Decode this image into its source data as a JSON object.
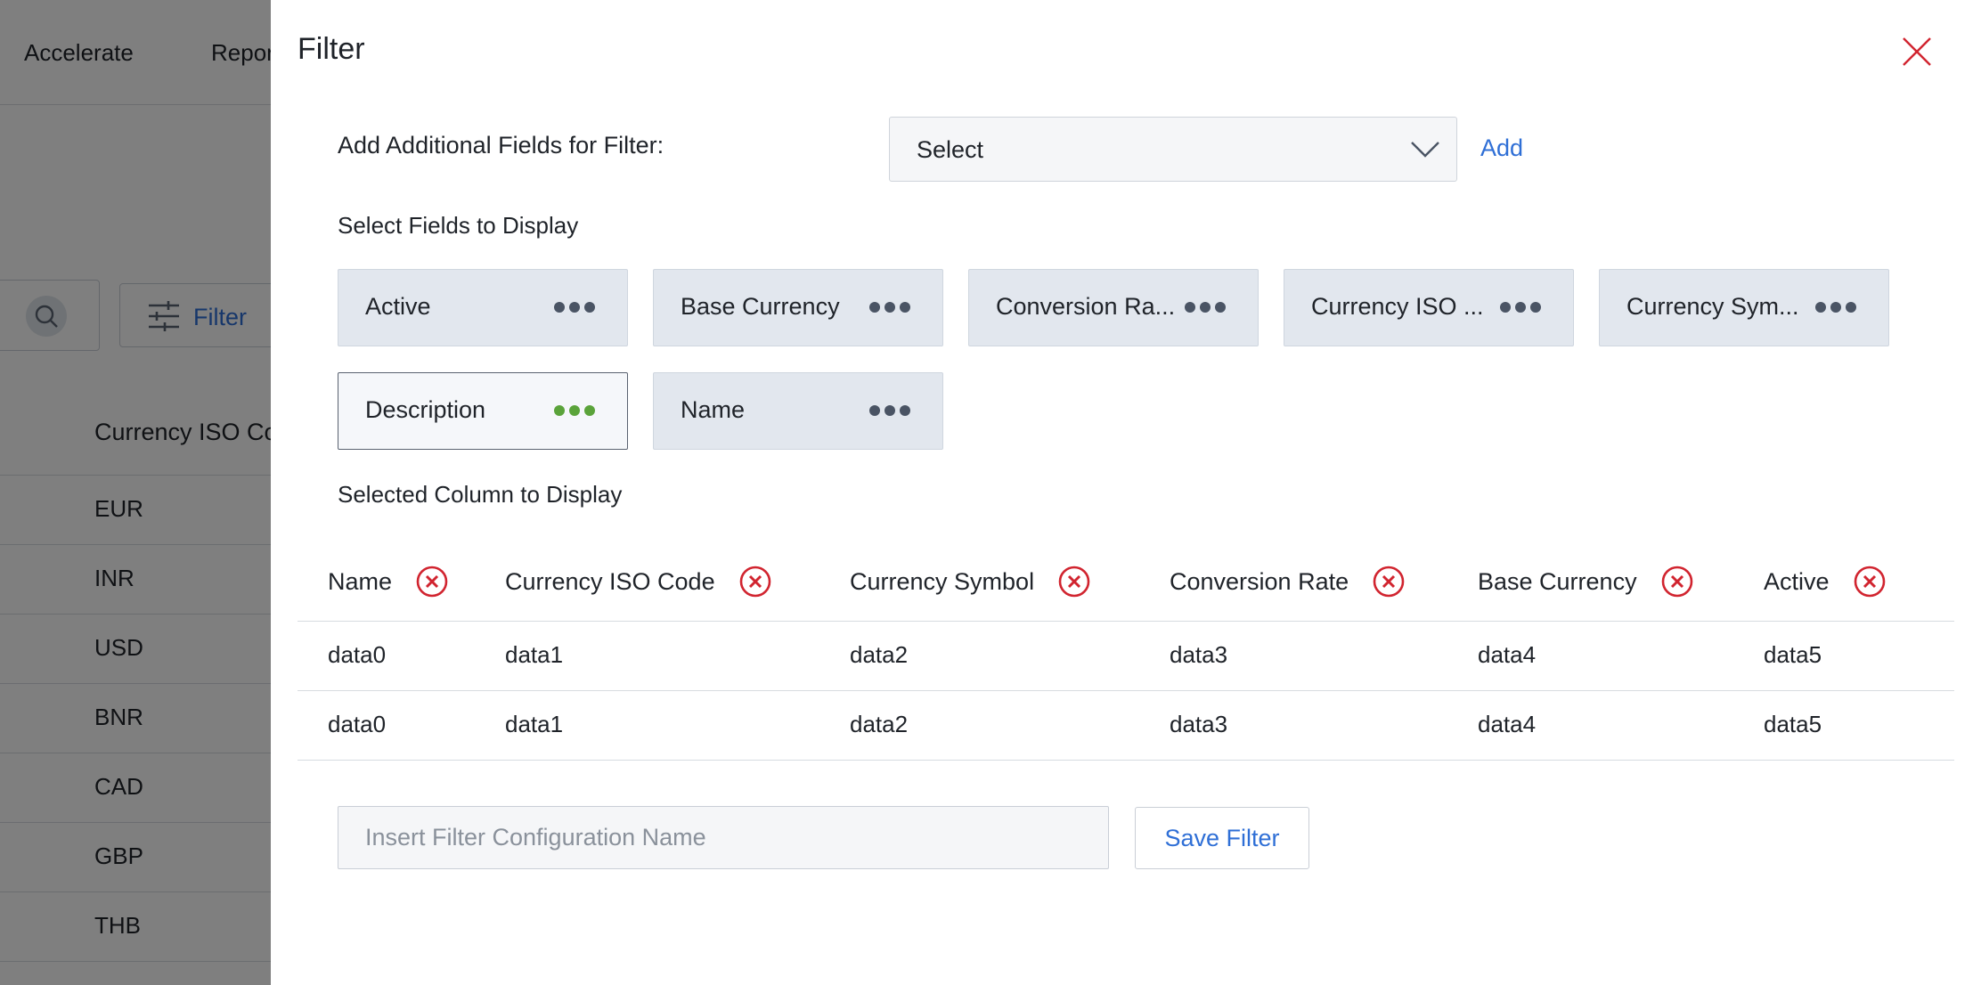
{
  "background": {
    "nav": [
      "Accelerate",
      "Repor"
    ],
    "filter_button_label": "Filter",
    "table_header": "Currency ISO Co",
    "table_rows": [
      "EUR",
      "INR",
      "USD",
      "BNR",
      "CAD",
      "GBP",
      "THB"
    ]
  },
  "drawer": {
    "title": "Filter",
    "add_fields_label": "Add Additional Fields for Filter:",
    "select_value": "Select",
    "add_link": "Add",
    "fields_label": "Select Fields to Display",
    "fields": [
      {
        "label": "Active",
        "selected": false
      },
      {
        "label": "Base Currency",
        "selected": false
      },
      {
        "label": "Conversion Ra...",
        "selected": false
      },
      {
        "label": "Currency ISO ...",
        "selected": false
      },
      {
        "label": "Currency Sym...",
        "selected": false
      },
      {
        "label": "Description",
        "selected": true
      },
      {
        "label": "Name",
        "selected": false
      }
    ],
    "selected_columns_label": "Selected Column to Display",
    "columns": [
      "Name",
      "Currency ISO Code",
      "Currency Symbol",
      "Conversion Rate",
      "Base Currency",
      "Active"
    ],
    "rows": [
      [
        "data0",
        "data1",
        "data2",
        "data3",
        "data4",
        "data5"
      ],
      [
        "data0",
        "data1",
        "data2",
        "data3",
        "data4",
        "data5"
      ]
    ],
    "config_placeholder": "Insert Filter Configuration Name",
    "save_label": "Save Filter"
  },
  "colors": {
    "accent": "#2f6fd6",
    "remove_icon": "#d1242f",
    "selected_dots": "#5aa33a",
    "chip_bg": "#e2e7ee"
  },
  "icons": {
    "close": "close-icon",
    "remove": "remove-circle-icon",
    "more": "more-dots-icon",
    "dropdown": "chevron-down-icon",
    "search": "search-icon",
    "filter": "sliders-icon"
  }
}
